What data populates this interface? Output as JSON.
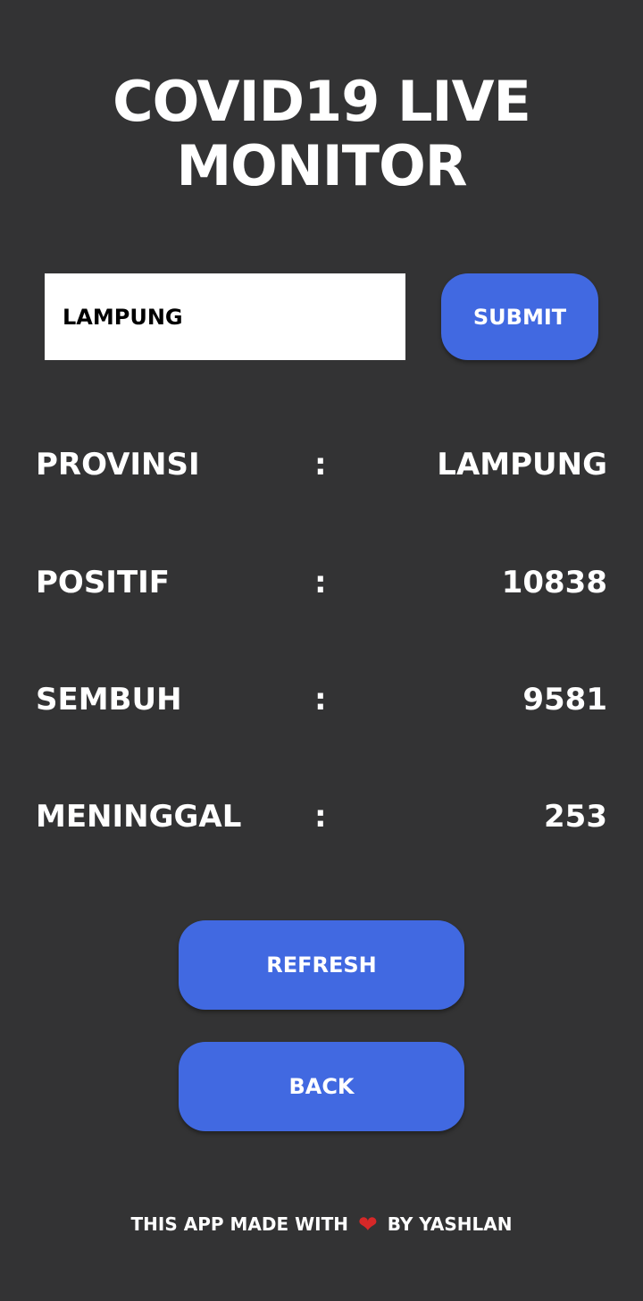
{
  "header": {
    "title_line1": "COVID19 LIVE",
    "title_line2": "MONITOR"
  },
  "search": {
    "value": "LAMPUNG",
    "submit_label": "SUBMIT"
  },
  "stats": [
    {
      "label": "PROVINSI",
      "separator": ":",
      "value": "LAMPUNG"
    },
    {
      "label": "POSITIF",
      "separator": ":",
      "value": "10838"
    },
    {
      "label": "SEMBUH",
      "separator": ":",
      "value": "9581"
    },
    {
      "label": "MENINGGAL",
      "separator": ":",
      "value": "253"
    }
  ],
  "actions": {
    "refresh_label": "REFRESH",
    "back_label": "BACK"
  },
  "footer": {
    "text_before": "THIS APP MADE WITH",
    "heart_icon": "heart-icon",
    "text_after": "BY YASHLAN"
  },
  "colors": {
    "background": "#333334",
    "accent": "#4169e1",
    "heart": "#d62828"
  }
}
